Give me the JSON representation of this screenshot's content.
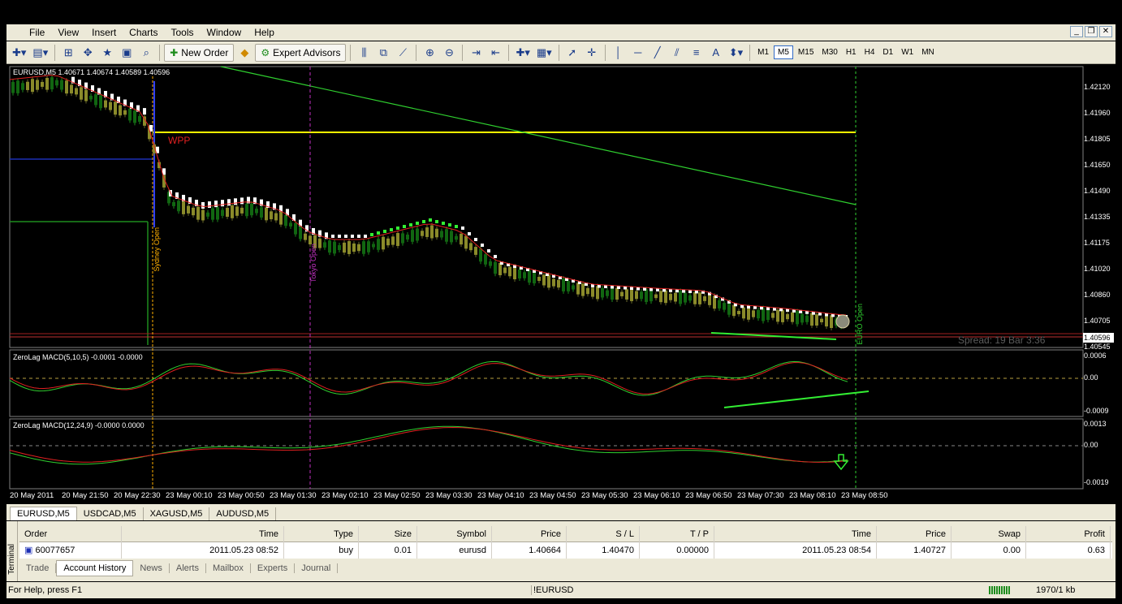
{
  "menu": {
    "items": [
      "File",
      "View",
      "Insert",
      "Charts",
      "Tools",
      "Window",
      "Help"
    ]
  },
  "toolbar": {
    "new_order": "New Order",
    "expert_advisors": "Expert Advisors",
    "timeframes": [
      "M1",
      "M5",
      "M15",
      "M30",
      "H1",
      "H4",
      "D1",
      "W1",
      "MN"
    ],
    "active_timeframe": "M5"
  },
  "chart": {
    "header": "EURUSD,M5  1.40671 1.40674 1.40589 1.40596",
    "wpp_label": "WPP",
    "sydney_label": "Sydney Open",
    "tokyo_label": "Tokyo Open",
    "euro_label": "EURO Open",
    "spread_text": "Spread: 19    Bar 3:36",
    "current_price": "1.40596",
    "price_ticks": [
      "1.42120",
      "1.41960",
      "1.41805",
      "1.41650",
      "1.41490",
      "1.41335",
      "1.41175",
      "1.41020",
      "1.40860",
      "1.40705",
      "1.40545"
    ],
    "macd1_title": "ZeroLag MACD(5,10,5) -0.0001 -0.0000",
    "macd1_ticks": [
      "0.0006",
      "0.00",
      "-0.0009"
    ],
    "macd2_title": "ZeroLag MACD(12,24,9) -0.0000 0.0000",
    "macd2_ticks": [
      "0.0013",
      "0.00",
      "-0.0019"
    ],
    "time_labels": [
      "20 May 2011",
      "20 May 21:50",
      "20 May 22:30",
      "23 May 00:10",
      "23 May 00:50",
      "23 May 01:30",
      "23 May 02:10",
      "23 May 02:50",
      "23 May 03:30",
      "23 May 04:10",
      "23 May 04:50",
      "23 May 05:30",
      "23 May 06:10",
      "23 May 06:50",
      "23 May 07:30",
      "23 May 08:10",
      "23 May 08:50"
    ]
  },
  "chart_tabs": [
    "EURUSD,M5",
    "USDCAD,M5",
    "XAGUSD,M5",
    "AUDUSD,M5"
  ],
  "terminal": {
    "side_label": "Terminal",
    "columns": [
      "Order",
      "Time",
      "Type",
      "Size",
      "Symbol",
      "Price",
      "S / L",
      "T / P",
      "Time",
      "Price",
      "Swap",
      "Profit"
    ],
    "rows": [
      [
        "60077657",
        "2011.05.23 08:52",
        "buy",
        "0.01",
        "eurusd",
        "1.40664",
        "1.40470",
        "0.00000",
        "2011.05.23 08:54",
        "1.40727",
        "0.00",
        "0.63"
      ]
    ],
    "tabs": [
      "Trade",
      "Account History",
      "News",
      "Alerts",
      "Mailbox",
      "Experts",
      "Journal"
    ],
    "active_tab": "Account History"
  },
  "status": {
    "help": "For Help, press F1",
    "profile": "!EURUSD",
    "traffic": "1970/1 kb"
  }
}
